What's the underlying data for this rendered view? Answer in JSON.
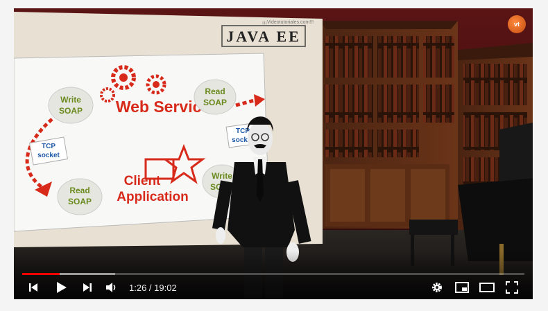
{
  "player": {
    "current_time": "1:26",
    "duration": "19:02",
    "time_separator": " / ",
    "progress_played": 0.075,
    "progress_buffered": 0.185
  },
  "slide": {
    "site_url": "¡¡¡Videotutoriales.com!!!",
    "heading": "JAVA EE",
    "web_service": "Web Service",
    "client_app_line1": "Client",
    "client_app_line2": "Application",
    "write_soap_top": "Write SOAP",
    "read_soap_top": "Read SOAP",
    "read_soap_bottom": "Read SOAP",
    "write_soap_bottom": "Write SOAP",
    "tcp_left": "TCP socket",
    "tcp_right": "TCP socket"
  },
  "watermark": {
    "text": "vt"
  },
  "icons": {
    "previous": "previous-icon",
    "play": "play-icon",
    "next": "next-icon",
    "volume": "volume-icon",
    "settings": "gear-icon",
    "miniplayer": "miniplayer-icon",
    "theater": "theater-mode-icon",
    "fullscreen": "fullscreen-icon"
  },
  "colors": {
    "progress": "#ff0000",
    "slide_red": "#d72a1a",
    "slide_blue": "#1e5aa8",
    "slide_green": "#6a8a1e"
  }
}
